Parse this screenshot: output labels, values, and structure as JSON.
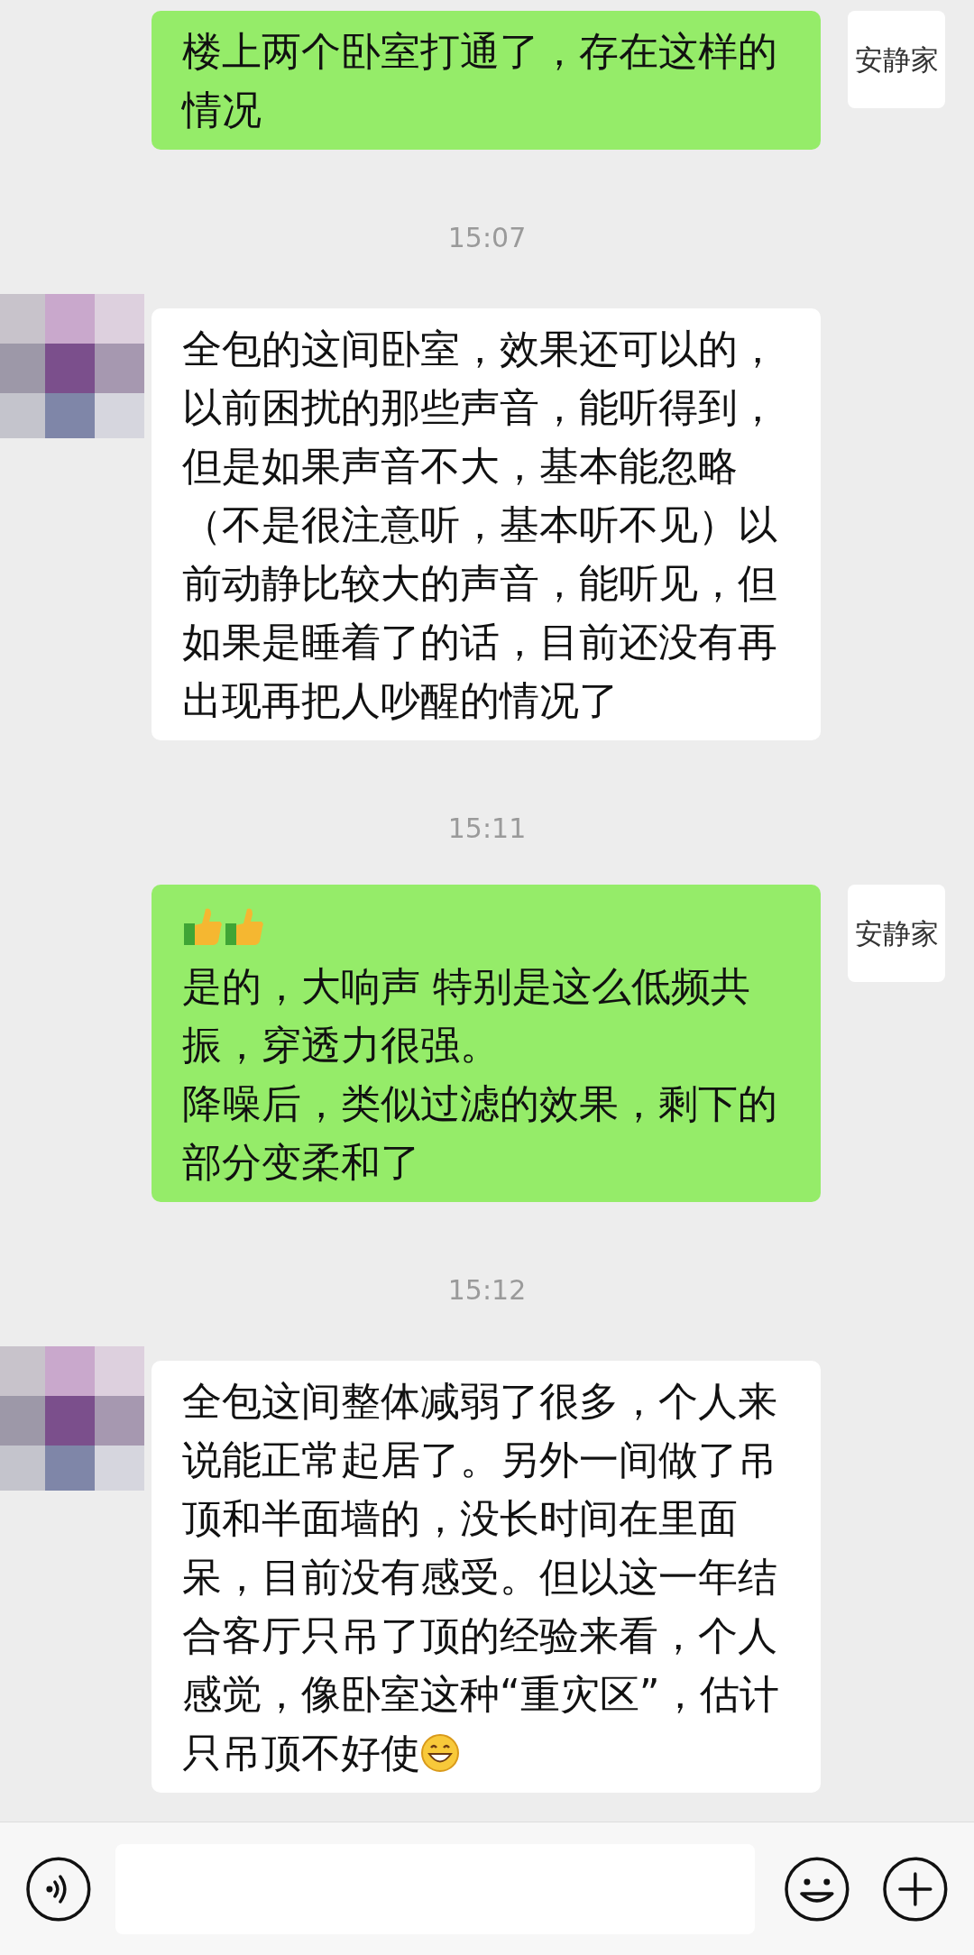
{
  "chat": [
    {
      "kind": "sent",
      "avatar_text": "安静家",
      "parts": [
        {
          "kind": "text",
          "text": "楼上两个卧室打通了，存在这样的情况"
        }
      ]
    },
    {
      "kind": "time",
      "text": "15:07"
    },
    {
      "kind": "received",
      "parts": [
        {
          "kind": "text",
          "text": "全包的这间卧室，效果还可以的，以前困扰的那些声音，能听得到，但是如果声音不大，基本能忽略（不是很注意听，基本听不见）以前动静比较大的声音，能听见，但如果是睡着了的话，目前还没有再出现再把人吵醒的情况了"
        }
      ]
    },
    {
      "kind": "time",
      "text": "15:11"
    },
    {
      "kind": "sent",
      "avatar_text": "安静家",
      "parts": [
        {
          "kind": "thumbs"
        },
        {
          "kind": "thumbs"
        },
        {
          "kind": "text",
          "text": "是的，大响声 特别是这么低频共振，穿透力很强。"
        },
        {
          "kind": "text",
          "text": "降噪后，类似过滤的效果，剩下的部分变柔和了"
        }
      ]
    },
    {
      "kind": "time",
      "text": "15:12"
    },
    {
      "kind": "received",
      "parts": [
        {
          "kind": "text",
          "text": "全包这间整体减弱了很多，个人来说能正常起居了。另外一间做了吊顶和半面墙的，没长时间在里面呆，目前没有感受。但以这一年结合客厅只吊了顶的经验来看，个人感觉，像卧室这种“重灾区”，估计"
        },
        {
          "kind": "text_grin",
          "text": "只吊顶不好使"
        }
      ]
    }
  ]
}
